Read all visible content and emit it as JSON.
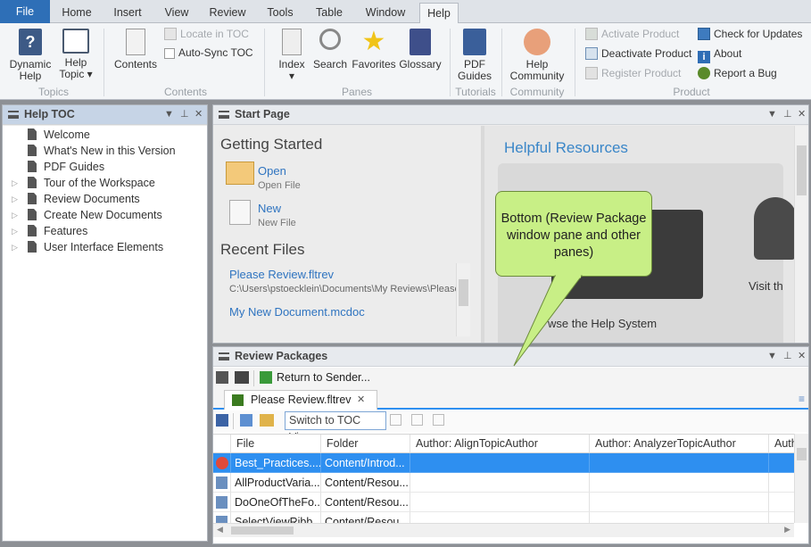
{
  "tabs": {
    "file": "File",
    "home": "Home",
    "insert": "Insert",
    "view": "View",
    "review": "Review",
    "tools": "Tools",
    "table": "Table",
    "window": "Window",
    "help": "Help"
  },
  "ribbon": {
    "dynamic_help": "Dynamic Help",
    "help_topic": "Help Topic",
    "contents": "Contents",
    "locate_in_toc": "Locate in TOC",
    "auto_sync_toc": "Auto-Sync TOC",
    "index": "Index",
    "search": "Search",
    "favorites": "Favorites",
    "glossary": "Glossary",
    "pdf_guides": "PDF Guides",
    "help_community": "Help Community",
    "activate_product": "Activate Product",
    "deactivate_product": "Deactivate Product",
    "register_product": "Register Product",
    "check_for_updates": "Check for Updates",
    "about": "About",
    "report_a_bug": "Report a Bug",
    "groups": {
      "topics": "Topics",
      "contents": "Contents",
      "panes": "Panes",
      "tutorials": "Tutorials",
      "community": "Community",
      "product": "Product"
    }
  },
  "help_toc": {
    "title": "Help TOC",
    "items": [
      "Welcome",
      "What's New in this Version",
      "PDF Guides",
      "Tour of the Workspace",
      "Review Documents",
      "Create New Documents",
      "Features",
      "User Interface Elements"
    ]
  },
  "start_page": {
    "title": "Start Page",
    "getting_started": "Getting Started",
    "open": "Open",
    "open_sub": "Open File",
    "new": "New",
    "new_sub": "New File",
    "recent_files": "Recent Files",
    "recent": [
      {
        "name": "Please Review.fltrev",
        "path": "C:\\Users\\pstoecklein\\Documents\\My Reviews\\Please"
      },
      {
        "name": "My New Document.mcdoc",
        "path": ""
      }
    ],
    "helpful_resources": "Helpful Resources",
    "browse": "wse the Help System",
    "visit": "Visit th"
  },
  "callout": "Bottom (Review Package window pane and other panes)",
  "review_packages": {
    "title": "Review Packages",
    "return_to_sender": "Return to Sender...",
    "doc_tab": "Please Review.fltrev",
    "switch_to_toc_view": "Switch to TOC View",
    "columns": [
      "File",
      "Folder",
      "Author: AlignTopicAuthor",
      "Author: AnalyzerTopicAuthor",
      "Auth"
    ],
    "rows": [
      [
        "Best_Practices....",
        "Content/Introd..."
      ],
      [
        "AllProductVaria...",
        "Content/Resou..."
      ],
      [
        "DoOneOfTheFo...",
        "Content/Resou..."
      ],
      [
        "SelectViewRibb...",
        "Content/Resou..."
      ]
    ]
  }
}
